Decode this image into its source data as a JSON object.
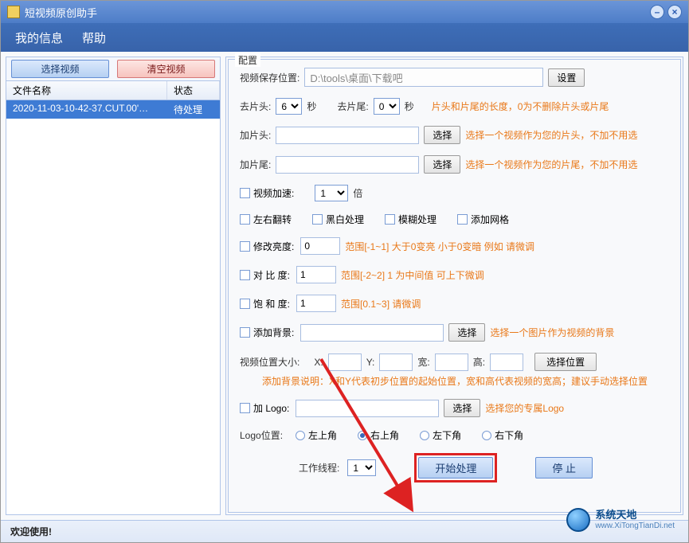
{
  "title": "短视频原创助手",
  "menu": {
    "info": "我的信息",
    "help": "帮助"
  },
  "left": {
    "select_video": "选择视频",
    "clear_video": "清空视频",
    "col_filename": "文件名称",
    "col_status": "状态",
    "files": [
      {
        "name": "2020-11-03-10-42-37.CUT.00'…",
        "status": "待处理"
      }
    ]
  },
  "config": {
    "legend": "配置",
    "save_label": "视频保存位置:",
    "save_value": "D:\\tools\\桌面\\下载吧",
    "set_btn": "设置",
    "trim_start_label": "去片头:",
    "trim_start_value": "6",
    "sec": "秒",
    "trim_end_label": "去片尾:",
    "trim_end_value": "0",
    "trim_hint": "片头和片尾的长度，0为不删除片头或片尾",
    "add_head_label": "加片头:",
    "pick_btn": "选择",
    "add_head_hint": "选择一个视频作为您的片头，不加不用选",
    "add_tail_label": "加片尾:",
    "add_tail_hint": "选择一个视频作为您的片尾，不加不用选",
    "speed_label": "视频加速:",
    "speed_value": "1",
    "speed_unit": "倍",
    "flip_label": "左右翻转",
    "bw_label": "黑白处理",
    "blur_label": "模糊处理",
    "grid_label": "添加网格",
    "brightness_label": "修改亮度:",
    "brightness_value": "0",
    "brightness_hint": "范围[-1~1]   大于0变亮 小于0变暗  例如 请微调",
    "contrast_label": "对 比  度:",
    "contrast_value": "1",
    "contrast_hint": "范围[-2~2]  1 为中间值  可上下微调",
    "saturation_label": "饱 和  度:",
    "saturation_value": "1",
    "saturation_hint": "范围[0.1~3]   请微调",
    "bg_label": "添加背景:",
    "bg_hint": "选择一个图片作为视频的背景",
    "pos_label": "视频位置大小:",
    "pos_x": "X:",
    "pos_y": "Y:",
    "pos_w": "宽:",
    "pos_h": "高:",
    "pos_btn": "选择位置",
    "pos_hint": "添加背景说明：X和Y代表初步位置的起始位置，宽和高代表视频的宽高；建议手动选择位置",
    "logo_label": "加 Logo:",
    "logo_hint": "选择您的专属Logo",
    "logo_pos_label": "Logo位置:",
    "radio_tl": "左上角",
    "radio_tr": "右上角",
    "radio_bl": "左下角",
    "radio_br": "右下角",
    "threads_label": "工作线程:",
    "threads_value": "1",
    "start_btn": "开始处理",
    "stop_btn": "停    止"
  },
  "status": "欢迎使用!",
  "watermark": {
    "cn": "系统天地",
    "en": "www.XiTongTianDi.net"
  }
}
